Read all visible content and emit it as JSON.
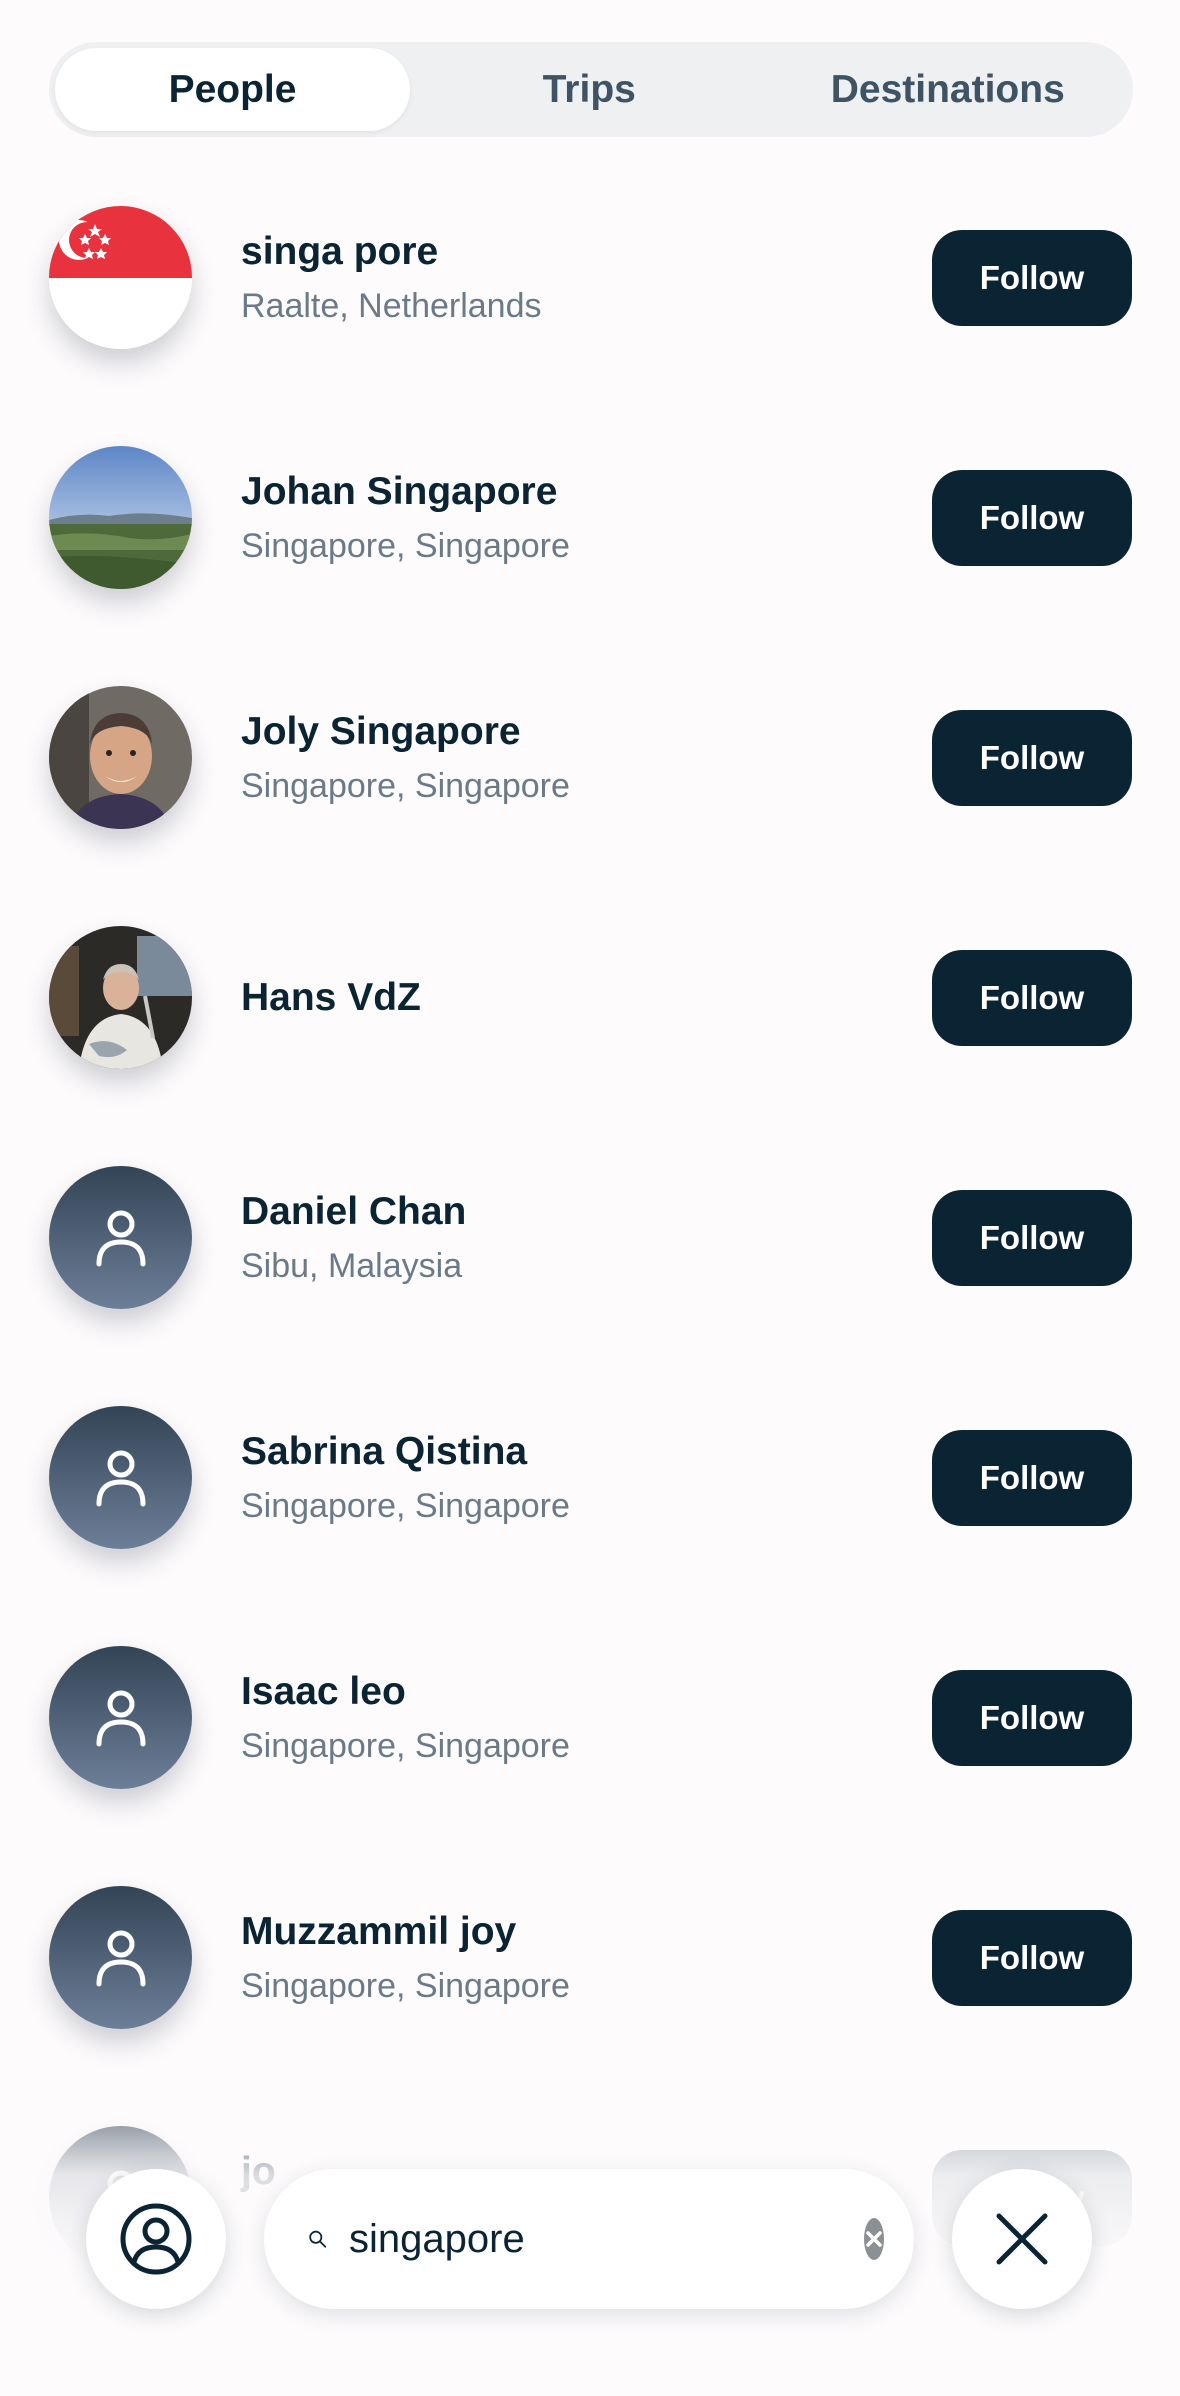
{
  "tabs": [
    {
      "label": "People",
      "active": true
    },
    {
      "label": "Trips",
      "active": false
    },
    {
      "label": "Destinations",
      "active": false
    }
  ],
  "follow_label": "Follow",
  "people": [
    {
      "name": "singa pore",
      "location": "Raalte, Netherlands",
      "avatar": "singapore-flag"
    },
    {
      "name": "Johan Singapore",
      "location": "Singapore, Singapore",
      "avatar": "landscape-photo"
    },
    {
      "name": "Joly Singapore",
      "location": "Singapore, Singapore",
      "avatar": "portrait-photo"
    },
    {
      "name": "Hans VdZ",
      "location": "",
      "avatar": "portrait-photo"
    },
    {
      "name": "Daniel Chan",
      "location": "Sibu, Malaysia",
      "avatar": "default-user-icon"
    },
    {
      "name": "Sabrina Qistina",
      "location": "Singapore, Singapore",
      "avatar": "default-user-icon"
    },
    {
      "name": "Isaac leo",
      "location": "Singapore, Singapore",
      "avatar": "default-user-icon"
    },
    {
      "name": "Muzzammil joy",
      "location": "Singapore, Singapore",
      "avatar": "default-user-icon"
    },
    {
      "name": "jo",
      "location": "",
      "avatar": "default-user-icon"
    }
  ],
  "search": {
    "value": "singapore",
    "placeholder": ""
  },
  "icons": {
    "profile": "user-circle-icon",
    "search": "search-icon",
    "clear": "clear-icon",
    "close": "close-icon"
  },
  "colors": {
    "accent": "#0b2433",
    "tab_track": "#eef0f2",
    "secondary_text": "#6a7a88",
    "placeholder_avatar": "#4d5d73"
  }
}
